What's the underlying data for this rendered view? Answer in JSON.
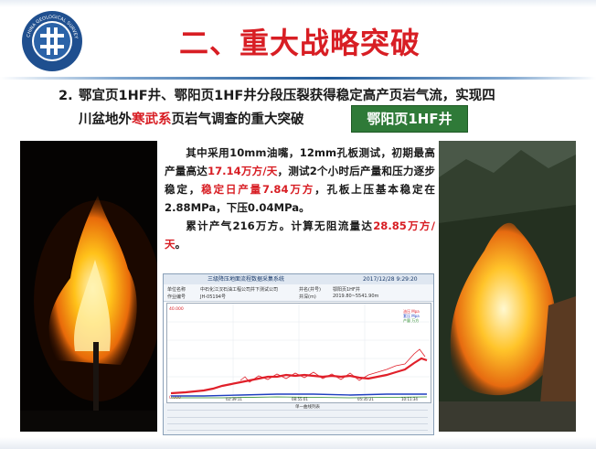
{
  "header": {
    "title": "二、重大战略突破",
    "logo_text": "CHINA GEOLOGICAL SURVEY"
  },
  "point": {
    "number": "2.",
    "line1": "鄂宜页1HF井、鄂阳页1HF井分段压裂获得稳定高产页岩气流，实现四",
    "line2_pre": "川盆地外",
    "line2_red": "寒武系",
    "line2_post": "页岩气调查的重大突破",
    "badge": "鄂阳页1HF井"
  },
  "body": {
    "p1_a": "其中采用10mm油嘴，12mm孔板测试，初期最高产量高达",
    "p1_b": "17.14万方/天",
    "p1_c": "，测试2个小时后产量和压力逐步稳定，",
    "p1_d": "稳定日产量7.84万方",
    "p1_e": "，孔板上压基本稳定在2.88MPa，下压0.04MPa。",
    "p2_a": "累计产气216万方。计算无阻流量达",
    "p2_b": "28.85万方/天",
    "p2_c": "。"
  },
  "screen": {
    "title": "三级降压地面流程数据采集系统",
    "datetime": "2017/12/28   9:29:20",
    "info": [
      "单位名称",
      "中石化江汉石油工程公司井下测试公司",
      "井名(井号)",
      "鄂阳页1HF井",
      "作业编号",
      "JH-05194号",
      "井深(m)",
      "2019.80~5541.90m"
    ],
    "legend": [
      "油压 Mpa",
      "套压 Mpa",
      "产量 万方"
    ],
    "xticks": [
      "02:39:11",
      "08:55:01",
      "05:35:21",
      "10:11:34"
    ],
    "y_max": "40.000",
    "y_min": "0.000",
    "toolbar": "单一曲线列表",
    "colors": {
      "red": "#e0202a",
      "blue": "#1f3fbf",
      "title_red": "#d81e24",
      "badge_green": "#2f7a38"
    }
  }
}
